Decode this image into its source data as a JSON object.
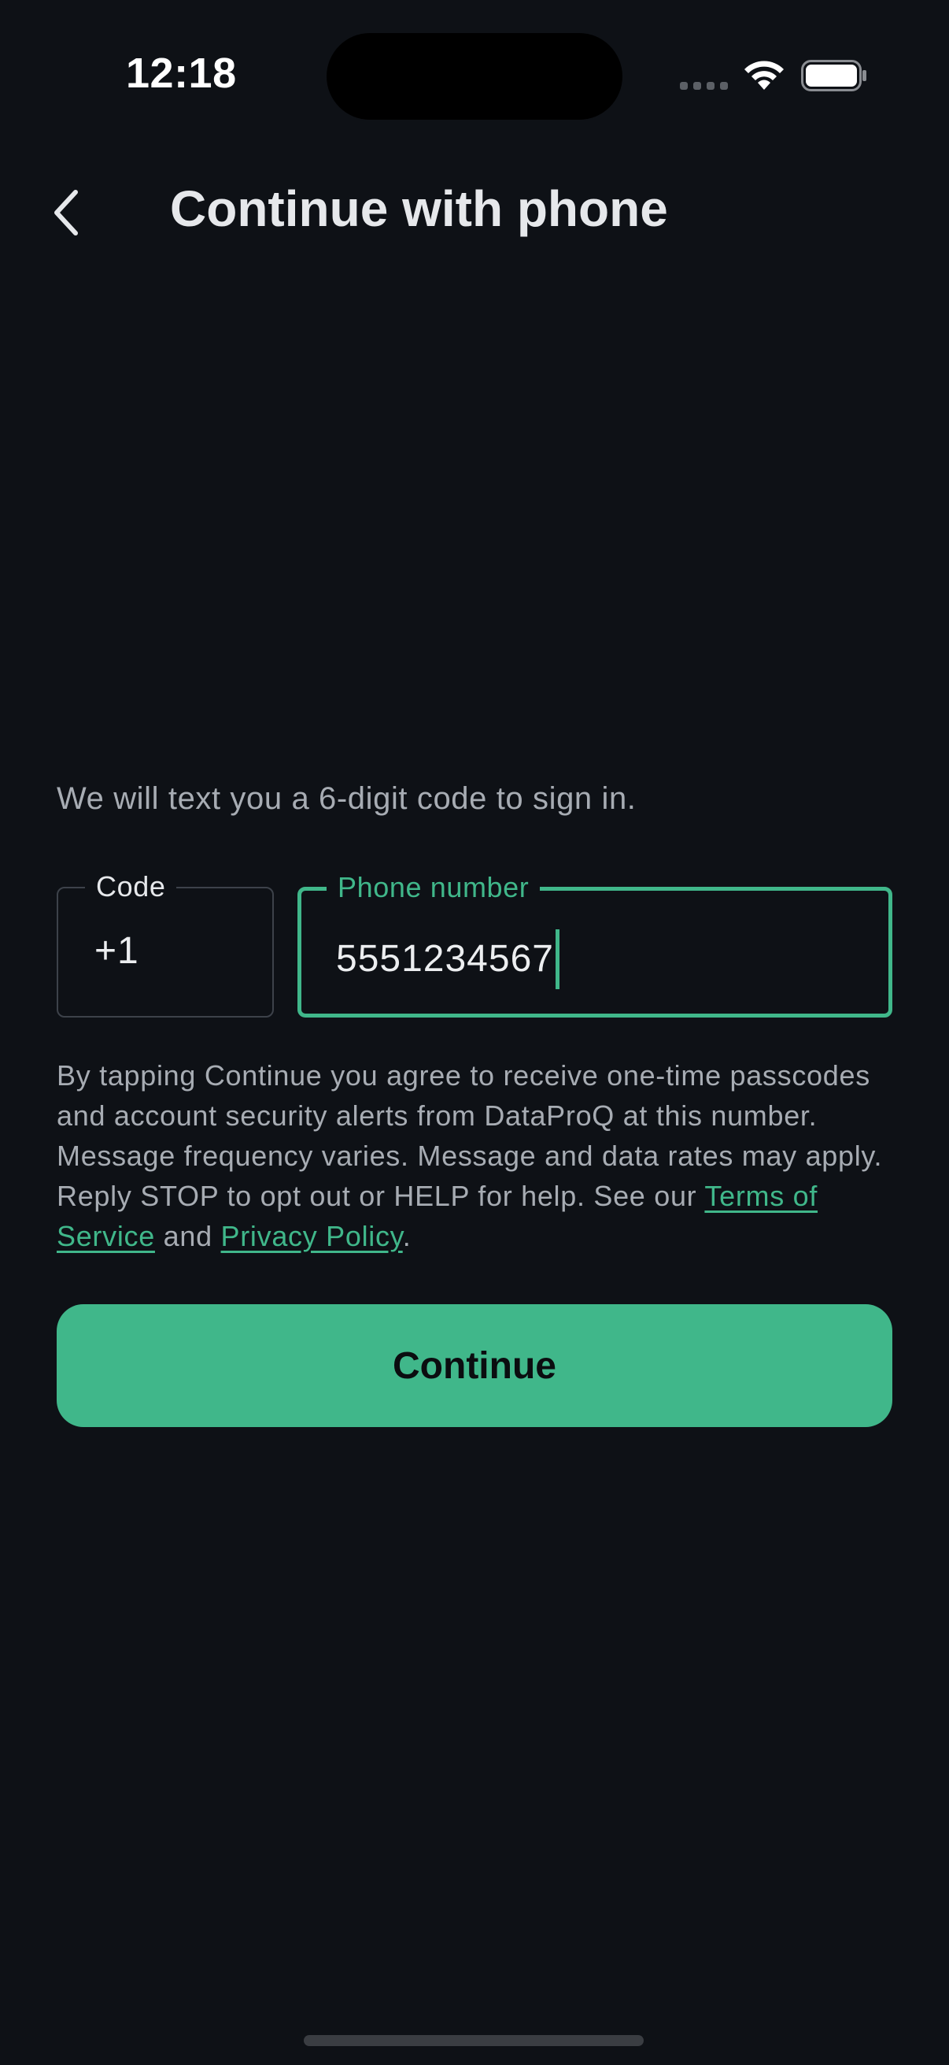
{
  "status_bar": {
    "time": "12:18",
    "icons": [
      "signal-dots-icon",
      "wifi-icon",
      "battery-icon"
    ]
  },
  "header": {
    "back_icon": "chevron-left-icon",
    "title": "Continue with phone"
  },
  "intro": "We will text you a 6-digit code to sign in.",
  "code_field": {
    "label": "Code",
    "value": "+1"
  },
  "phone_field": {
    "label": "Phone number",
    "value": "5551234567",
    "focused": true
  },
  "consent": {
    "text_before": "By tapping Continue you agree to receive one-time passcodes and account security alerts from DataProQ at this number. Message frequency varies. Message and data rates may apply. Reply STOP to opt out or HELP for help. See our ",
    "terms_link": "Terms of Service",
    "text_middle": " and ",
    "privacy_link": "Privacy Policy",
    "text_after": "."
  },
  "continue_button": {
    "label": "Continue"
  },
  "colors": {
    "background": "#0e1116",
    "accent": "#40b78a",
    "muted_text": "#a7acb3",
    "primary_text": "#e6e8eb"
  }
}
